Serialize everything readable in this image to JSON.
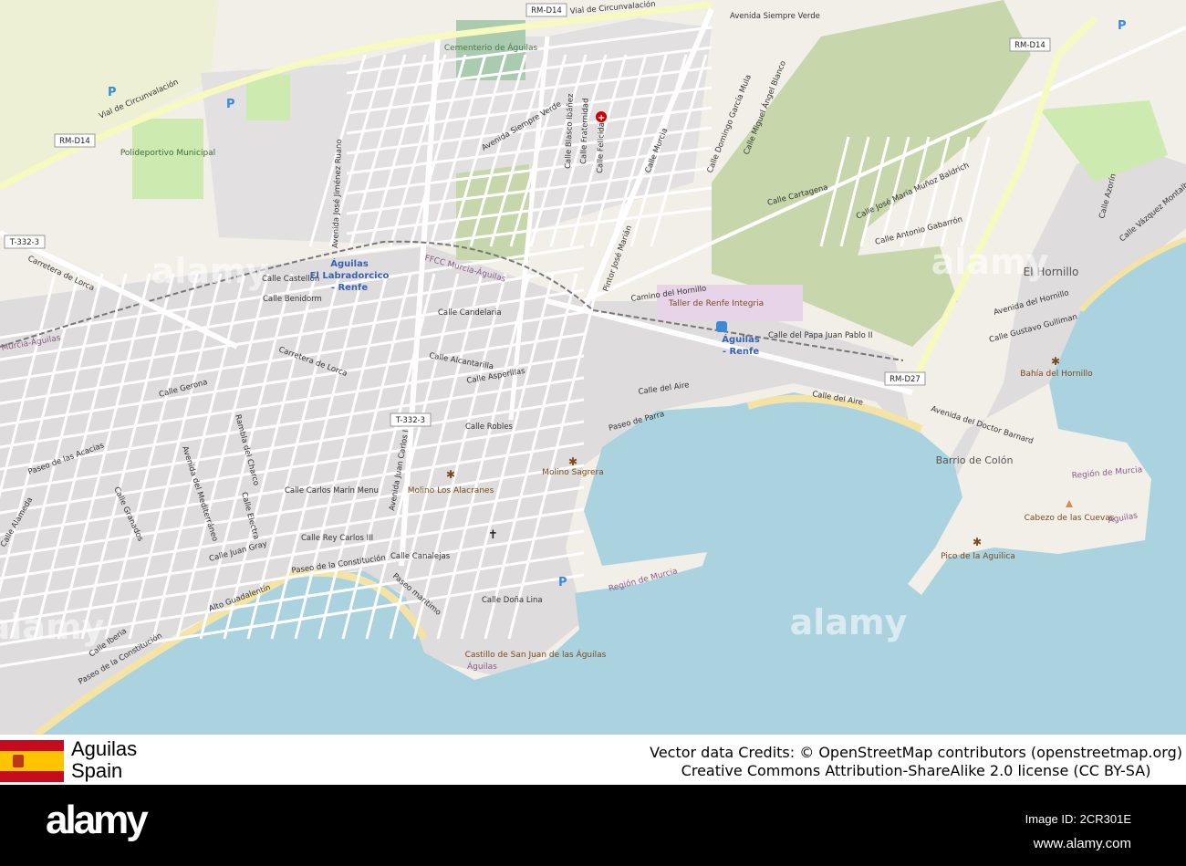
{
  "colors": {
    "land": "#f2efe9",
    "builtup": "#dddddd",
    "sea": "#aad3df",
    "park": "#cdebb0",
    "scrub": "#c8d7ab",
    "road": "#ffffff",
    "primary": "#f7fabf",
    "beach": "#fff1ba"
  },
  "map": {
    "roads": [
      "RM-D14",
      "RM-D14",
      "RM-D14",
      "T-332-3",
      "T-332-3",
      "RM-D27"
    ],
    "streets": [
      "Vial de Circunvalación",
      "Vial de Circunvalación",
      "Avenida Siempre Verde",
      "Avenida Siempre Verde",
      "Carretera de Lorca",
      "Carretera de Lorca",
      "Calle Castellón",
      "Calle Benidorm",
      "Calle Candelaria",
      "Calle Alcantarilla",
      "Calle Asperillas",
      "Calle Robles",
      "Calle Gerona",
      "Paseo de las Acacias",
      "Calle Carlos Marín Menu",
      "Calle Rey Carlos III",
      "Calle Canalejas",
      "Calle Juan Gray",
      "Calle Doña Lina",
      "Paseo de la Constitución",
      "Paseo de la Constitución",
      "Paseo de Parra",
      "Calle del Aire",
      "Calle del Aire",
      "Calle del Papa Juan Pablo II",
      "Camino del Hornillo",
      "Calle Cartagena",
      "Calle Antonio Gabarrón",
      "Calle José María Muñoz Baldrich",
      "Avenida del Hornillo",
      "Calle Gustavo Gulliman",
      "Avenida del Doctor Barnard",
      "Calle Iberia",
      "Alto Guadalentín",
      "Paseo marítimo",
      "Avenida José Jiménez Ruano",
      "Calle Murcia",
      "Calle Domingo García Mula",
      "Calle Miguel Ángel Blanco",
      "Pintor José Marián",
      "Calle Blasco Ibáñez",
      "Calle Fraternidad",
      "Calle Felicidad",
      "Avenida Juan Carlos I",
      "Avenida del Mediterráneo",
      "Rambla del Charco",
      "Calle Alameda",
      "Calle Granados",
      "Calle Electra",
      "Calle Azorín",
      "Calle Vázquez Montalbán"
    ],
    "pois": [
      "Cementerio de Águilas",
      "Polideportivo Municipal",
      "Taller de Renfe Integria",
      "Molino Los Alacranes",
      "Molino Sagrera",
      "Castillo de San Juan de las Águilas",
      "Bahía del Hornillo",
      "Cabezo de las Cuevas",
      "Pico de la Aguilica",
      "Barrio de Colón"
    ],
    "stations": [
      "Águilas",
      "El Labradorcico",
      "- Renfe",
      "Águilas",
      "- Renfe"
    ],
    "places": [
      "El Hornillo"
    ],
    "boundaries": [
      "Región de Murcia",
      "Región de Murcia",
      "Águilas",
      "Águilas",
      "FFCC Murcia-Águilas",
      "Murcia-Águilas"
    ],
    "watermarks": [
      "alamy",
      "alamy",
      "alamy",
      "alamy"
    ]
  },
  "footer": {
    "city": "Aguilas",
    "country": "Spain",
    "credits_line1": "Vector data Credits: © OpenStreetMap contributors (openstreetmap.org)",
    "credits_line2": "Creative Commons Attribution-ShareAlike 2.0 license (CC BY-SA)",
    "flag": "spain-flag"
  },
  "bar": {
    "logo": "alamy",
    "image_id": "Image ID: 2CR301E",
    "website": "www.alamy.com"
  }
}
